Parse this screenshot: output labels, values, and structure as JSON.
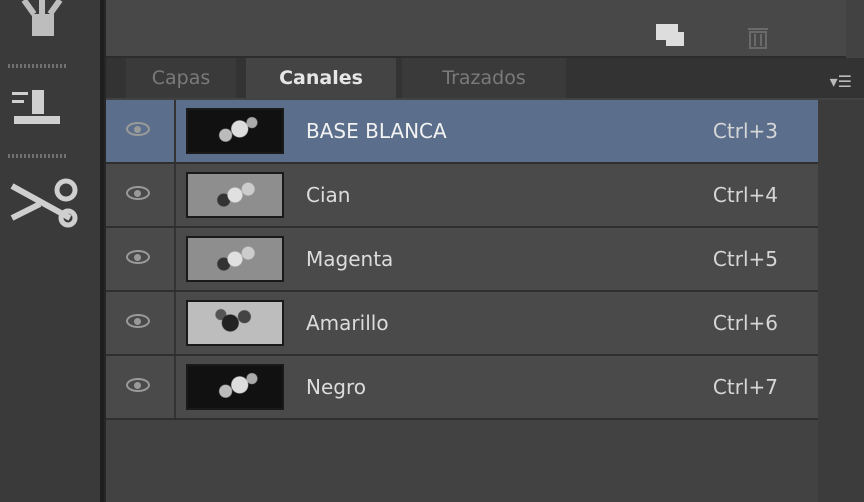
{
  "tabs": [
    {
      "label": "Capas",
      "active": false
    },
    {
      "label": "Canales",
      "active": true
    },
    {
      "label": "Trazados",
      "active": false
    }
  ],
  "channels": [
    {
      "name": "BASE BLANCA",
      "shortcut": "Ctrl+3",
      "selected": true,
      "visible": true
    },
    {
      "name": "Cian",
      "shortcut": "Ctrl+4",
      "selected": false,
      "visible": true
    },
    {
      "name": "Magenta",
      "shortcut": "Ctrl+5",
      "selected": false,
      "visible": true
    },
    {
      "name": "Amarillo",
      "shortcut": "Ctrl+6",
      "selected": false,
      "visible": true
    },
    {
      "name": "Negro",
      "shortcut": "Ctrl+7",
      "selected": false,
      "visible": true
    }
  ],
  "icons": {
    "panel_menu": "panel-menu-icon",
    "new_channel": "new-channel-icon",
    "delete": "trash-icon"
  },
  "colors": {
    "selected_row": "#5b6f8c",
    "panel_bg": "#424242"
  }
}
